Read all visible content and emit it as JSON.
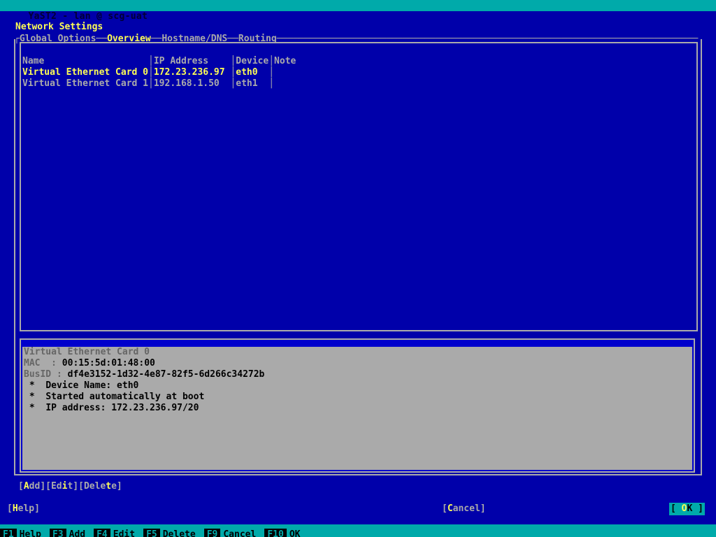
{
  "titlebar": {
    "text": "YaST2 - lan @ scg-uat"
  },
  "header": {
    "page_title": "Network Settings"
  },
  "tabs": [
    {
      "label": "Global Options",
      "active": false
    },
    {
      "label": "Overview",
      "active": true
    },
    {
      "label": "Hostname/DNS",
      "active": false
    },
    {
      "label": "Routing",
      "active": false
    }
  ],
  "table": {
    "columns": [
      "Name",
      "IP Address",
      "Device",
      "Note"
    ],
    "rows": [
      {
        "name": "Virtual Ethernet Card 0",
        "ip_address": "172.23.236.97",
        "device": "eth0",
        "note": "",
        "selected": true
      },
      {
        "name": "Virtual Ethernet Card 1",
        "ip_address": "192.168.1.50",
        "device": "eth1",
        "note": "",
        "selected": false
      }
    ]
  },
  "detail": {
    "title": "Virtual Ethernet Card 0",
    "mac_label": "MAC  :",
    "mac_value": "00:15:5d:01:48:00",
    "busid_label": "BusID :",
    "busid_value": "df4e3152-1d32-4e87-82f5-6d266c34272b",
    "bullets": [
      "Device Name: eth0",
      "Started automatically at boot",
      "IP address: 172.23.236.97/20"
    ],
    "bullet_glyph": "*"
  },
  "action_buttons": [
    {
      "prefix": "[",
      "pre": "",
      "hotkey": "A",
      "post": "dd",
      "suffix": "]"
    },
    {
      "prefix": "[",
      "pre": "Ed",
      "hotkey": "i",
      "post": "t",
      "suffix": "]"
    },
    {
      "prefix": "[",
      "pre": "Dele",
      "hotkey": "t",
      "post": "e",
      "suffix": "]"
    }
  ],
  "dialog_buttons": {
    "help": {
      "prefix": "[",
      "pre": "",
      "hotkey": "H",
      "post": "elp",
      "suffix": "]"
    },
    "cancel": {
      "prefix": "[",
      "pre": "",
      "hotkey": "C",
      "post": "ancel",
      "suffix": "]"
    },
    "ok": {
      "prefix": "[ ",
      "pre": "",
      "hotkey": "O",
      "post": "K",
      "suffix": " ]"
    }
  },
  "function_keys": [
    {
      "key": "F1",
      "label": "Help"
    },
    {
      "key": "F3",
      "label": "Add"
    },
    {
      "key": "F4",
      "label": "Edit"
    },
    {
      "key": "F5",
      "label": "Delete"
    },
    {
      "key": "F9",
      "label": "Cancel"
    },
    {
      "key": "F10",
      "label": "OK"
    }
  ],
  "colors": {
    "background": "#0000aa",
    "accent_cyan": "#00aaaa",
    "highlight_yellow": "#ffff55",
    "frame_gray": "#aaaaaa",
    "panel_gray": "#aaaaaa"
  }
}
